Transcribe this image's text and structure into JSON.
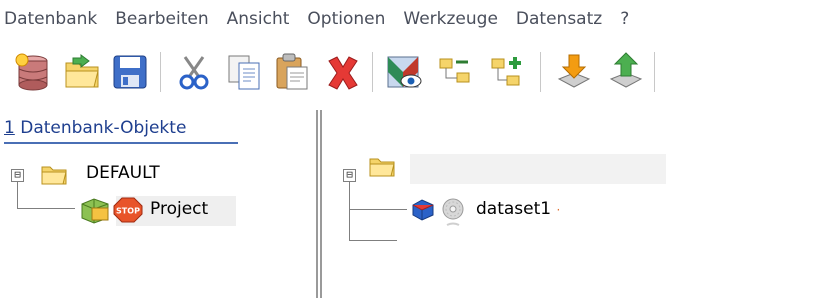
{
  "menu": {
    "items": [
      "Datenbank",
      "Bearbeiten",
      "Ansicht",
      "Optionen",
      "Werkzeuge",
      "Datensatz",
      "?"
    ]
  },
  "toolbar": {
    "buttons": [
      {
        "icon": "new-database-icon"
      },
      {
        "icon": "open-folder-icon"
      },
      {
        "icon": "save-icon"
      },
      {
        "icon": "cut-icon"
      },
      {
        "icon": "copy-icon"
      },
      {
        "icon": "paste-icon"
      },
      {
        "icon": "delete-icon"
      },
      {
        "icon": "view-icon"
      },
      {
        "icon": "tree-collapse-icon"
      },
      {
        "icon": "tree-add-icon"
      },
      {
        "icon": "import-icon"
      },
      {
        "icon": "export-icon"
      }
    ]
  },
  "left_pane": {
    "title_number": "1",
    "title_text": " Datenbank-Objekte",
    "tree": {
      "root": {
        "label": "DEFAULT",
        "expander": "⊟"
      },
      "child": {
        "label": "Project",
        "stop_badge": "STOP"
      }
    }
  },
  "right_pane": {
    "tree": {
      "root": {
        "label": "",
        "expander": "⊟"
      },
      "child": {
        "label": "dataset1",
        "suffix": "·"
      }
    }
  },
  "colors": {
    "menu_text": "#4a4f5c",
    "title_text": "#1f3f8f",
    "tree_lines": "#7f7f7f"
  }
}
